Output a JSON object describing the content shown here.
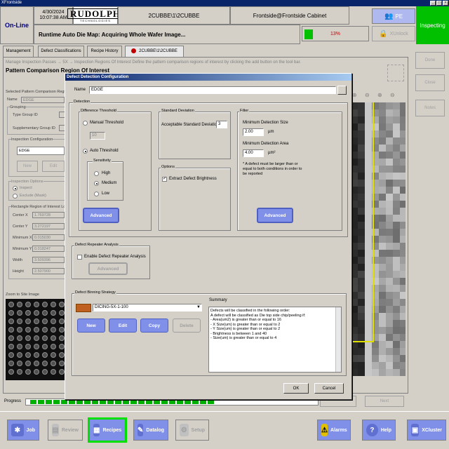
{
  "window": {
    "title": "XFrontside"
  },
  "header": {
    "status": "On-Line",
    "date": "4/30/2024",
    "time": "10:07:38 AM",
    "logo_brand": "RUDOLPH",
    "logo_sub": "TECHNOLOGIES",
    "recipe_title": "2CUBBE\\1\\2CUBBE",
    "user_title": "Frontside@Frontside Cabinet",
    "status_message": "Runtime Auto Die Map: Acquiring Whole Wafer Image...",
    "progress_percent": 13,
    "progress_label": "13%",
    "user_button": "PE",
    "lock_button": "XUnlock",
    "mode": "Inspecting"
  },
  "tabs": [
    {
      "label": "Management"
    },
    {
      "label": "Defect Classifications"
    },
    {
      "label": "Recipe History"
    },
    {
      "label": "2CUBBE\\1\\2CUBBE"
    }
  ],
  "page": {
    "breadcrumbs": "Manage Inspection Passes → 5X → Inspection Regions Of Interest     Define the pattern comparison regions of interest by clicking the add button on the tool bar.",
    "section_title": "Pattern Comparison Region Of Interest"
  },
  "right_buttons": [
    "Done",
    "Close",
    "Notes"
  ],
  "left_panel": {
    "selected_title": "Selected Pattern Comparison Region",
    "name_label": "Name",
    "name_value": "EDGE",
    "grouping_label": "Grouping",
    "type_group_label": "Type Group ID",
    "supp_group_label": "Supplementary Group ID",
    "inspection_config_label": "Inspection Configuration",
    "inspection_config_value": "EDGE",
    "new_label": "New",
    "edit_label": "Edit",
    "inspection_options_label": "Inspection Options",
    "inspect_label": "Inspect",
    "exclude_label": "Exclude (Mask)",
    "rect_title": "Rectangle Region of Interest Lo",
    "fields": [
      {
        "label": "Center X",
        "value": "1.769728"
      },
      {
        "label": "Center Y",
        "value": "3.272197"
      },
      {
        "label": "Minimum X",
        "value": "0.015030"
      },
      {
        "label": "Minimum Y",
        "value": "0.018247"
      },
      {
        "label": "Width",
        "value": "3.509396"
      },
      {
        "label": "Height",
        "value": "2.507900"
      }
    ],
    "zoom_label": "Zoom to Site Image"
  },
  "dialog": {
    "title": "Defect Detection Configuration",
    "name_label": "Name",
    "name_value": "EDGE",
    "detection_label": "Detection",
    "diff_threshold": {
      "title": "Difference Threshold",
      "manual_label": "Manual Threshold",
      "manual_value": "10",
      "auto_label": "Auto Threshold",
      "sensitivity_title": "Sensitivity",
      "high": "High",
      "medium": "Medium",
      "low": "Low",
      "advanced": "Advanced"
    },
    "std_dev": {
      "title": "Standard Deviation",
      "acceptable_label": "Acceptable Standard Deviation",
      "acceptable_value": "3"
    },
    "options": {
      "title": "Options",
      "extract_label": "Extract Defect Brightness"
    },
    "filter": {
      "title": "Filter",
      "min_size_label": "Minimum Detection Size",
      "min_size_value": "2.00",
      "min_size_unit": "µm",
      "min_area_label": "Minimum Detection Area",
      "min_area_value": "4.00",
      "min_area_unit": "µm²",
      "note": "* A defect must be larger than or equal to both conditions in order to be reported",
      "advanced": "Advanced"
    },
    "repeater": {
      "title": "Defect Repeater Analysis",
      "enable_label": "Enable Defect Repeater Analysis",
      "advanced": "Advanced"
    },
    "binning": {
      "title": "Defect Binning Strategy",
      "strategy_value": "DICING-5X-1-100",
      "summary_label": "Summary",
      "new": "New",
      "edit": "Edit",
      "copy": "Copy",
      "delete": "Delete",
      "summary_lines": [
        "Defects will be classified in the following order:",
        "A defect will be classified as Die top side chip/peeling if:",
        "- Area(um2) is greater than or equal to 16",
        "- X Size(um) is greater than or equal to 2",
        "- Y Size(um) is greater than or equal to 2",
        "- Brightness is between 1 and 40",
        "- Size(um) is greater than or equal to 4"
      ]
    },
    "ok": "OK",
    "cancel": "Cancel"
  },
  "progress": {
    "label": "Progress",
    "next_label": "Next"
  },
  "bottom_nav": [
    {
      "label": "Job"
    },
    {
      "label": "Review"
    },
    {
      "label": "Recipes"
    },
    {
      "label": "Datalog"
    },
    {
      "label": "Setup"
    },
    {
      "label": "Alarms"
    },
    {
      "label": "Help"
    },
    {
      "label": "XCluster"
    }
  ]
}
